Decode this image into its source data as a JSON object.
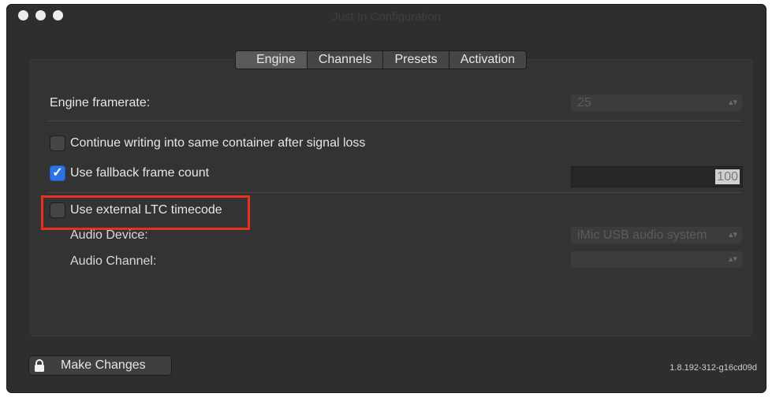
{
  "window": {
    "title": "Just In Configuration"
  },
  "tabs": [
    {
      "label": "Engine",
      "selected": true
    },
    {
      "label": "Channels",
      "selected": false
    },
    {
      "label": "Presets",
      "selected": false
    },
    {
      "label": "Activation",
      "selected": false
    }
  ],
  "engine": {
    "framerate_label": "Engine framerate:",
    "framerate_value": "25",
    "continue_writing_label": "Continue writing into same container after signal loss",
    "continue_writing_checked": false,
    "fallback_label": "Use fallback frame count",
    "fallback_checked": true,
    "fallback_value": "100",
    "ltc_label": "Use external LTC timecode",
    "ltc_checked": false,
    "audio_device_label": "Audio Device:",
    "audio_device_value": "iMic USB audio system",
    "audio_channel_label": "Audio Channel:",
    "audio_channel_value": ""
  },
  "footer": {
    "make_changes_label": "Make Changes",
    "version": "1.8.192-312-g16cd09d"
  },
  "colors": {
    "window_bg": "#2e2e2e",
    "checkbox_checked": "#2b74e6",
    "highlight": "#e8301c"
  },
  "icons": {
    "checkmark": "✓",
    "popup_arrows": "⌃⌄"
  }
}
